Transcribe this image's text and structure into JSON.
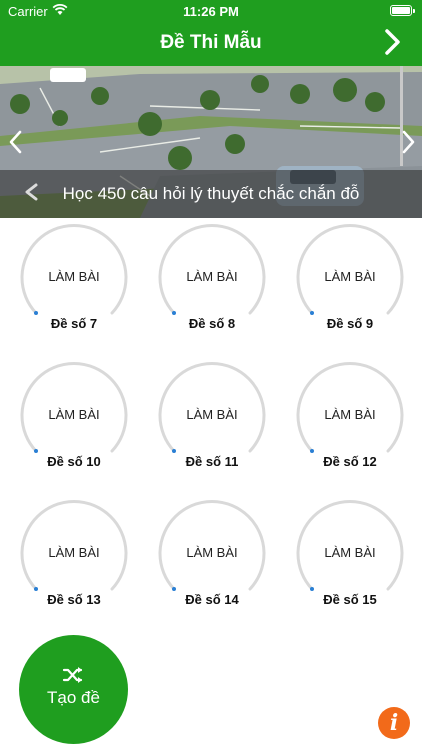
{
  "status_bar": {
    "carrier": "Carrier",
    "time": "11:26 PM"
  },
  "nav": {
    "title": "Đề Thi Mẫu",
    "next_icon": "chevron-right-icon"
  },
  "banner": {
    "caption": "Học 450 câu hỏi lý thuyết chắc chắn đỗ",
    "prev_icon": "chevron-left-icon",
    "next_icon": "chevron-right-icon"
  },
  "exams": {
    "action_label": "LÀM BÀI",
    "items": [
      {
        "label": "Đề số 7"
      },
      {
        "label": "Đề số 8"
      },
      {
        "label": "Đề số 9"
      },
      {
        "label": "Đề số 10"
      },
      {
        "label": "Đề số 11"
      },
      {
        "label": "Đề số 12"
      },
      {
        "label": "Đề số 13"
      },
      {
        "label": "Đề số 14"
      },
      {
        "label": "Đề số 15"
      }
    ]
  },
  "fab": {
    "label": "Tạo đề",
    "icon": "shuffle-icon"
  },
  "info_button": {
    "glyph": "i",
    "icon": "info-icon"
  },
  "colors": {
    "primary": "#1f9e1f",
    "ring": "#d9d9d9",
    "progress": "#2a7fd4",
    "info": "#f26a1a"
  }
}
